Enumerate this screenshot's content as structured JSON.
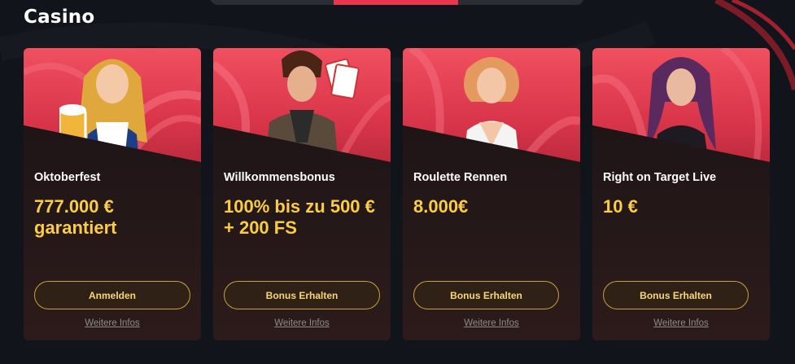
{
  "page": {
    "title": "Casino"
  },
  "tabs_strip": {
    "active_index": 1
  },
  "colors": {
    "accent": "#e8364c",
    "offer_text": "#fbcd43",
    "button_border": "#c8a23a",
    "background": "#11141b"
  },
  "cards": [
    {
      "name": "Oktoberfest",
      "offer": "777.000 € garantiert",
      "button": "Anmelden",
      "link": "Weitere Infos",
      "illustration": "oktoberfest-woman-icon"
    },
    {
      "name": "Willkommensbonus",
      "offer": "100% bis zu 500 € + 200 FS",
      "button": "Bonus Erhalten",
      "link": "Weitere Infos",
      "illustration": "gambler-man-icon"
    },
    {
      "name": "Roulette Rennen",
      "offer": "8.000€",
      "button": "Bonus Erhalten",
      "link": "Weitere Infos",
      "illustration": "roulette-woman-icon"
    },
    {
      "name": "Right on Target Live",
      "offer": "10 €",
      "button": "Bonus Erhalten",
      "link": "Weitere Infos",
      "illustration": "target-woman-icon"
    }
  ]
}
